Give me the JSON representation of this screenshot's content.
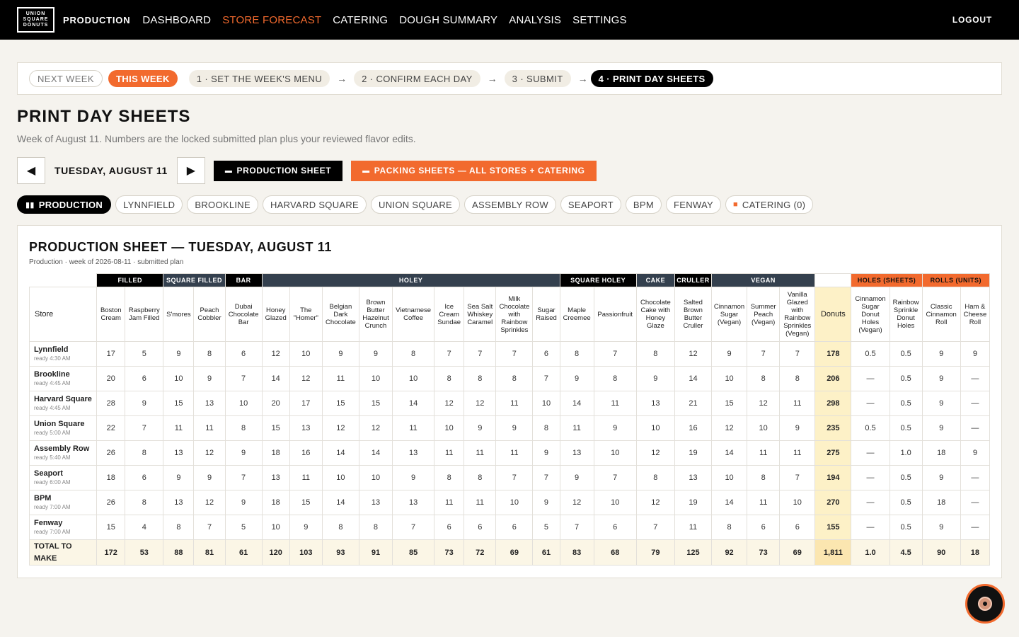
{
  "logo": {
    "line1": "UNION",
    "line2": "SQUARE",
    "line3": "DONUTS"
  },
  "nav": {
    "brand": "PRODUCTION",
    "items": [
      "DASHBOARD",
      "STORE FORECAST",
      "CATERING",
      "DOUGH SUMMARY",
      "ANALYSIS",
      "SETTINGS"
    ],
    "active": "STORE FORECAST",
    "logout": "LOGOUT"
  },
  "steps": {
    "next_week": "NEXT WEEK",
    "this_week": "THIS WEEK",
    "s1": "1 · SET THE WEEK'S MENU",
    "s2": "2 · CONFIRM EACH DAY",
    "s3": "3 · SUBMIT",
    "s4": "4 · PRINT DAY SHEETS",
    "arrow": "→"
  },
  "page": {
    "title": "PRINT DAY SHEETS",
    "subtitle": "Week of August 11. Numbers are the locked submitted plan plus your reviewed flavor edits."
  },
  "daybar": {
    "prev": "◀",
    "next": "▶",
    "day": "TUESDAY, AUGUST 11",
    "production_btn": "PRODUCTION SHEET",
    "packing_btn": "PACKING SHEETS — ALL STORES + CATERING",
    "print_icon": "▬"
  },
  "store_tabs": {
    "production": "PRODUCTION",
    "production_icon": "▮▮",
    "stores": [
      "LYNNFIELD",
      "BROOKLINE",
      "HARVARD SQUARE",
      "UNION SQUARE",
      "ASSEMBLY ROW",
      "SEAPORT",
      "BPM",
      "FENWAY"
    ],
    "catering": "CATERING (0)",
    "catering_icon": "■"
  },
  "sheet": {
    "title": "PRODUCTION SHEET — TUESDAY, AUGUST 11",
    "subtitle": "Production · week of 2026-08-11 · submitted plan",
    "groups": {
      "filled": "FILLED",
      "square_filled": "SQUARE FILLED",
      "bar": "BAR",
      "holey": "HOLEY",
      "square_holey": "SQUARE HOLEY",
      "cake": "CAKE",
      "cruller": "CRULLER",
      "vegan": "VEGAN",
      "holes": "HOLES (SHEETS)",
      "rolls": "ROLLS (UNITS)"
    },
    "columns": {
      "store": "Store",
      "c1": "Boston Cream",
      "c2": "Raspberry Jam Filled",
      "c3": "S'mores",
      "c4": "Peach Cobbler",
      "c5": "Dubai Chocolate Bar",
      "c6": "Honey Glazed",
      "c7": "The \"Homer\"",
      "c8": "Belgian Dark Chocolate",
      "c9": "Brown Butter Hazelnut Crunch",
      "c10": "Vietnamese Coffee",
      "c11": "Ice Cream Sundae",
      "c12": "Sea Salt Whiskey Caramel",
      "c13": "Milk Chocolate with Rainbow Sprinkles",
      "c14": "Sugar Raised",
      "c15": "Maple Creemee",
      "c16": "Passionfruit",
      "c17": "Chocolate Cake with Honey Glaze",
      "c18": "Salted Brown Butter Cruller",
      "c19": "Cinnamon Sugar (Vegan)",
      "c20": "Summer Peach (Vegan)",
      "c21": "Vanilla Glazed with Rainbow Sprinkles (Vegan)",
      "donuts": "Donuts",
      "c22": "Cinnamon Sugar Donut Holes (Vegan)",
      "c23": "Rainbow Sprinkle Donut Holes",
      "c24": "Classic Cinnamon Roll",
      "c25": "Ham & Cheese Roll"
    },
    "rows": [
      {
        "store": "Lynnfield",
        "ready": "ready 4:30 AM",
        "v": [
          "17",
          "5",
          "9",
          "8",
          "6",
          "12",
          "10",
          "9",
          "9",
          "8",
          "7",
          "7",
          "7",
          "6",
          "8",
          "7",
          "8",
          "12",
          "9",
          "7",
          "7",
          "178",
          "0.5",
          "0.5",
          "9",
          "9"
        ]
      },
      {
        "store": "Brookline",
        "ready": "ready 4:45 AM",
        "v": [
          "20",
          "6",
          "10",
          "9",
          "7",
          "14",
          "12",
          "11",
          "10",
          "10",
          "8",
          "8",
          "8",
          "7",
          "9",
          "8",
          "9",
          "14",
          "10",
          "8",
          "8",
          "206",
          "—",
          "0.5",
          "9",
          "—"
        ]
      },
      {
        "store": "Harvard Square",
        "ready": "ready 4:45 AM",
        "v": [
          "28",
          "9",
          "15",
          "13",
          "10",
          "20",
          "17",
          "15",
          "15",
          "14",
          "12",
          "12",
          "11",
          "10",
          "14",
          "11",
          "13",
          "21",
          "15",
          "12",
          "11",
          "298",
          "—",
          "0.5",
          "9",
          "—"
        ]
      },
      {
        "store": "Union Square",
        "ready": "ready 5:00 AM",
        "v": [
          "22",
          "7",
          "11",
          "11",
          "8",
          "15",
          "13",
          "12",
          "12",
          "11",
          "10",
          "9",
          "9",
          "8",
          "11",
          "9",
          "10",
          "16",
          "12",
          "10",
          "9",
          "235",
          "0.5",
          "0.5",
          "9",
          "—"
        ]
      },
      {
        "store": "Assembly Row",
        "ready": "ready 5:40 AM",
        "v": [
          "26",
          "8",
          "13",
          "12",
          "9",
          "18",
          "16",
          "14",
          "14",
          "13",
          "11",
          "11",
          "11",
          "9",
          "13",
          "10",
          "12",
          "19",
          "14",
          "11",
          "11",
          "275",
          "—",
          "1.0",
          "18",
          "9"
        ]
      },
      {
        "store": "Seaport",
        "ready": "ready 6:00 AM",
        "v": [
          "18",
          "6",
          "9",
          "9",
          "7",
          "13",
          "11",
          "10",
          "10",
          "9",
          "8",
          "8",
          "7",
          "7",
          "9",
          "7",
          "8",
          "13",
          "10",
          "8",
          "7",
          "194",
          "—",
          "0.5",
          "9",
          "—"
        ]
      },
      {
        "store": "BPM",
        "ready": "ready 7:00 AM",
        "v": [
          "26",
          "8",
          "13",
          "12",
          "9",
          "18",
          "15",
          "14",
          "13",
          "13",
          "11",
          "11",
          "10",
          "9",
          "12",
          "10",
          "12",
          "19",
          "14",
          "11",
          "10",
          "270",
          "—",
          "0.5",
          "18",
          "—"
        ]
      },
      {
        "store": "Fenway",
        "ready": "ready 7:00 AM",
        "v": [
          "15",
          "4",
          "8",
          "7",
          "5",
          "10",
          "9",
          "8",
          "8",
          "7",
          "6",
          "6",
          "6",
          "5",
          "7",
          "6",
          "7",
          "11",
          "8",
          "6",
          "6",
          "155",
          "—",
          "0.5",
          "9",
          "—"
        ]
      }
    ],
    "total": {
      "label": "TOTAL TO MAKE",
      "v": [
        "172",
        "53",
        "88",
        "81",
        "61",
        "120",
        "103",
        "93",
        "91",
        "85",
        "73",
        "72",
        "69",
        "61",
        "83",
        "68",
        "79",
        "125",
        "92",
        "73",
        "69",
        "1,811",
        "1.0",
        "4.5",
        "90",
        "18"
      ]
    }
  },
  "colors": {
    "accent": "#f26a2e",
    "nav_bg": "#000000",
    "group_slate": "#34404e",
    "donuts_highlight": "#fdf1c7"
  }
}
